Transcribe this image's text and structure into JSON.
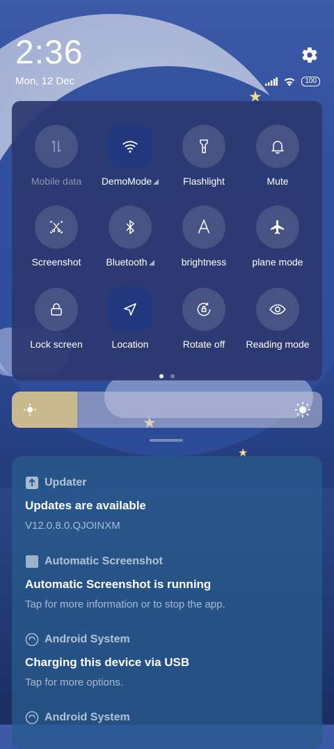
{
  "status": {
    "time": "2:36",
    "date": "Mon, 12 Dec",
    "battery": "100"
  },
  "quick_settings": {
    "tiles": [
      {
        "label": "Mobile data",
        "icon": "mobile-data-icon",
        "active": false,
        "dim": true
      },
      {
        "label": "DemoMode",
        "icon": "wifi-icon",
        "active": true,
        "expand": true
      },
      {
        "label": "Flashlight",
        "icon": "flashlight-icon",
        "active": false
      },
      {
        "label": "Mute",
        "icon": "bell-icon",
        "active": false
      },
      {
        "label": "Screenshot",
        "icon": "screenshot-icon",
        "active": false
      },
      {
        "label": "Bluetooth",
        "icon": "bluetooth-icon",
        "active": false,
        "expand": true
      },
      {
        "label": "brightness",
        "icon": "auto-brightness-icon",
        "active": false
      },
      {
        "label": "plane mode",
        "icon": "airplane-icon",
        "active": false
      },
      {
        "label": "Lock screen",
        "icon": "lock-icon",
        "active": false
      },
      {
        "label": "Location",
        "icon": "location-icon",
        "active": true
      },
      {
        "label": "Rotate off",
        "icon": "rotate-icon",
        "active": false
      },
      {
        "label": "Reading mode",
        "icon": "eye-icon",
        "active": false
      }
    ],
    "page": 1,
    "pages": 2
  },
  "brightness": {
    "level": 0.21
  },
  "notifications": [
    {
      "app": "Updater",
      "icon": "updater-icon",
      "title": "Updates are available",
      "body": "V12.0.8.0.QJOINXM"
    },
    {
      "app": "Automatic Screenshot",
      "icon": "app-square-icon",
      "title": "Automatic Screenshot is running",
      "body": "Tap for more information or to stop the app."
    },
    {
      "app": "Android System",
      "icon": "android-system-icon",
      "title": "Charging this device via USB",
      "body": "Tap for more options."
    },
    {
      "app": "Android System",
      "icon": "android-system-icon",
      "title": "",
      "body": ""
    }
  ]
}
